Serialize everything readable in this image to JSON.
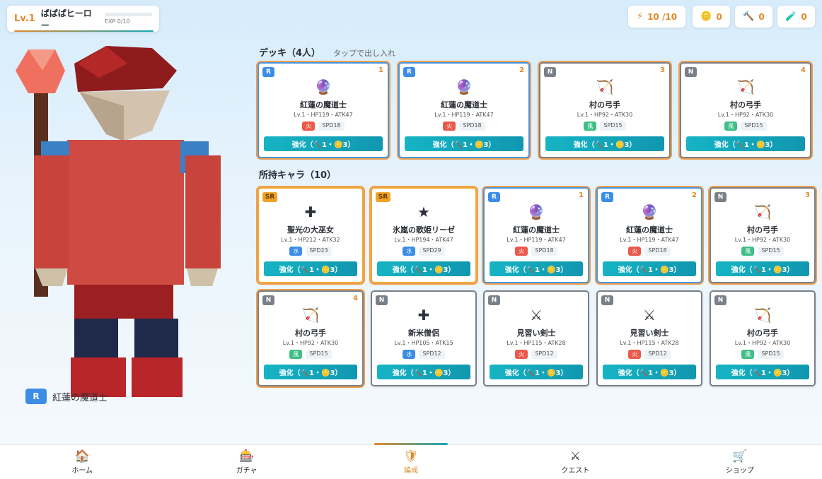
{
  "player": {
    "level": "Lv.1",
    "name": "ぱぱぱヒーロー",
    "exp": "EXP 0/10",
    "exp_progress": 0
  },
  "resources": [
    {
      "icon": "lightning-icon",
      "glyph": "⚡",
      "value": "10 /10"
    },
    {
      "icon": "coin-icon",
      "glyph": "🪙",
      "value": "0"
    },
    {
      "icon": "hammer-icon",
      "glyph": "🔨",
      "value": "0"
    },
    {
      "icon": "potion-icon",
      "glyph": "🧪",
      "value": "0"
    }
  ],
  "selected": {
    "rarity": "R",
    "name": "紅蓮の魔道士"
  },
  "deck": {
    "title": "デッキ（4人）",
    "hint": "タップで出し入れ",
    "cards": [
      {
        "rarity": "R",
        "slot": "1",
        "icon": "crystal-ball-icon",
        "glyph": "🔮",
        "name": "紅蓮の魔道士",
        "stats": "Lv.1・HP119・ATK47",
        "element": "火",
        "element_type": "fire",
        "spd": "SPD18",
        "button": "強化（🔨1・🪙3）"
      },
      {
        "rarity": "R",
        "slot": "2",
        "icon": "crystal-ball-icon",
        "glyph": "🔮",
        "name": "紅蓮の魔道士",
        "stats": "Lv.1・HP119・ATK47",
        "element": "火",
        "element_type": "fire",
        "spd": "SPD18",
        "button": "強化（🔨1・🪙3）"
      },
      {
        "rarity": "N",
        "slot": "3",
        "icon": "bow-icon",
        "glyph": "🏹",
        "name": "村の弓手",
        "stats": "Lv.1・HP92・ATK30",
        "element": "風",
        "element_type": "wind",
        "spd": "SPD15",
        "button": "強化（🔨1・🪙3）"
      },
      {
        "rarity": "N",
        "slot": "4",
        "icon": "bow-icon",
        "glyph": "🏹",
        "name": "村の弓手",
        "stats": "Lv.1・HP92・ATK30",
        "element": "風",
        "element_type": "wind",
        "spd": "SPD15",
        "button": "強化（🔨1・🪙3）"
      }
    ]
  },
  "owned": {
    "title": "所持キャラ（10）",
    "cards": [
      {
        "rarity": "SR",
        "slot": "",
        "in_deck": true,
        "icon": "cross-icon",
        "glyph": "✚",
        "name": "聖光の大巫女",
        "stats": "Lv.1・HP212・ATK32",
        "element": "水",
        "element_type": "water",
        "spd": "SPD23",
        "button": "強化（🔨1・🪙3）"
      },
      {
        "rarity": "SR",
        "slot": "",
        "in_deck": true,
        "icon": "star-icon",
        "glyph": "★",
        "name": "氷嵐の歌姫リーゼ",
        "stats": "Lv.1・HP194・ATK47",
        "element": "水",
        "element_type": "water",
        "spd": "SPD29",
        "button": "強化（🔨1・🪙3）"
      },
      {
        "rarity": "R",
        "slot": "1",
        "in_deck": true,
        "icon": "crystal-ball-icon",
        "glyph": "🔮",
        "name": "紅蓮の魔道士",
        "stats": "Lv.1・HP119・ATK47",
        "element": "火",
        "element_type": "fire",
        "spd": "SPD18",
        "button": "強化（🔨1・🪙3）"
      },
      {
        "rarity": "R",
        "slot": "2",
        "in_deck": true,
        "icon": "crystal-ball-icon",
        "glyph": "🔮",
        "name": "紅蓮の魔道士",
        "stats": "Lv.1・HP119・ATK47",
        "element": "火",
        "element_type": "fire",
        "spd": "SPD18",
        "button": "強化（🔨1・🪙3）"
      },
      {
        "rarity": "N",
        "slot": "3",
        "in_deck": true,
        "icon": "bow-icon",
        "glyph": "🏹",
        "name": "村の弓手",
        "stats": "Lv.1・HP92・ATK30",
        "element": "風",
        "element_type": "wind",
        "spd": "SPD15",
        "button": "強化（🔨1・🪙3）"
      },
      {
        "rarity": "N",
        "slot": "4",
        "in_deck": true,
        "icon": "bow-icon",
        "glyph": "🏹",
        "name": "村の弓手",
        "stats": "Lv.1・HP92・ATK30",
        "element": "風",
        "element_type": "wind",
        "spd": "SPD15",
        "button": "強化（🔨1・🪙3）"
      },
      {
        "rarity": "N",
        "slot": "",
        "in_deck": false,
        "icon": "cross-icon",
        "glyph": "✚",
        "name": "新米僧侶",
        "stats": "Lv.1・HP105・ATK15",
        "element": "水",
        "element_type": "water",
        "spd": "SPD12",
        "button": "強化（🔨1・🪙3）"
      },
      {
        "rarity": "N",
        "slot": "",
        "in_deck": false,
        "icon": "crossed-swords-icon",
        "glyph": "⚔",
        "name": "見習い剣士",
        "stats": "Lv.1・HP115・ATK28",
        "element": "火",
        "element_type": "fire",
        "spd": "SPD12",
        "button": "強化（🔨1・🪙3）"
      },
      {
        "rarity": "N",
        "slot": "",
        "in_deck": false,
        "icon": "crossed-swords-icon",
        "glyph": "⚔",
        "name": "見習い剣士",
        "stats": "Lv.1・HP115・ATK28",
        "element": "火",
        "element_type": "fire",
        "spd": "SPD12",
        "button": "強化（🔨1・🪙3）"
      },
      {
        "rarity": "N",
        "slot": "",
        "in_deck": false,
        "icon": "bow-icon",
        "glyph": "🏹",
        "name": "村の弓手",
        "stats": "Lv.1・HP92・ATK30",
        "element": "風",
        "element_type": "wind",
        "spd": "SPD15",
        "button": "強化（🔨1・🪙3）"
      }
    ]
  },
  "nav": [
    {
      "icon": "home-icon",
      "glyph": "🏠",
      "label": "ホーム",
      "active": false
    },
    {
      "icon": "slot-machine-icon",
      "glyph": "🎰",
      "label": "ガチャ",
      "active": false
    },
    {
      "icon": "shield-icon",
      "glyph": "🛡",
      "label": "編成",
      "active": true
    },
    {
      "icon": "crossed-swords-icon",
      "glyph": "⚔",
      "label": "クエスト",
      "active": false
    },
    {
      "icon": "shopping-cart-icon",
      "glyph": "🛒",
      "label": "ショップ",
      "active": false
    }
  ],
  "colors": {
    "accent": "#e08a2b",
    "button": "#16b4c4",
    "rarity_R": "#3b8de6",
    "rarity_N": "#7a8089",
    "rarity_SR": "#f1a326"
  }
}
